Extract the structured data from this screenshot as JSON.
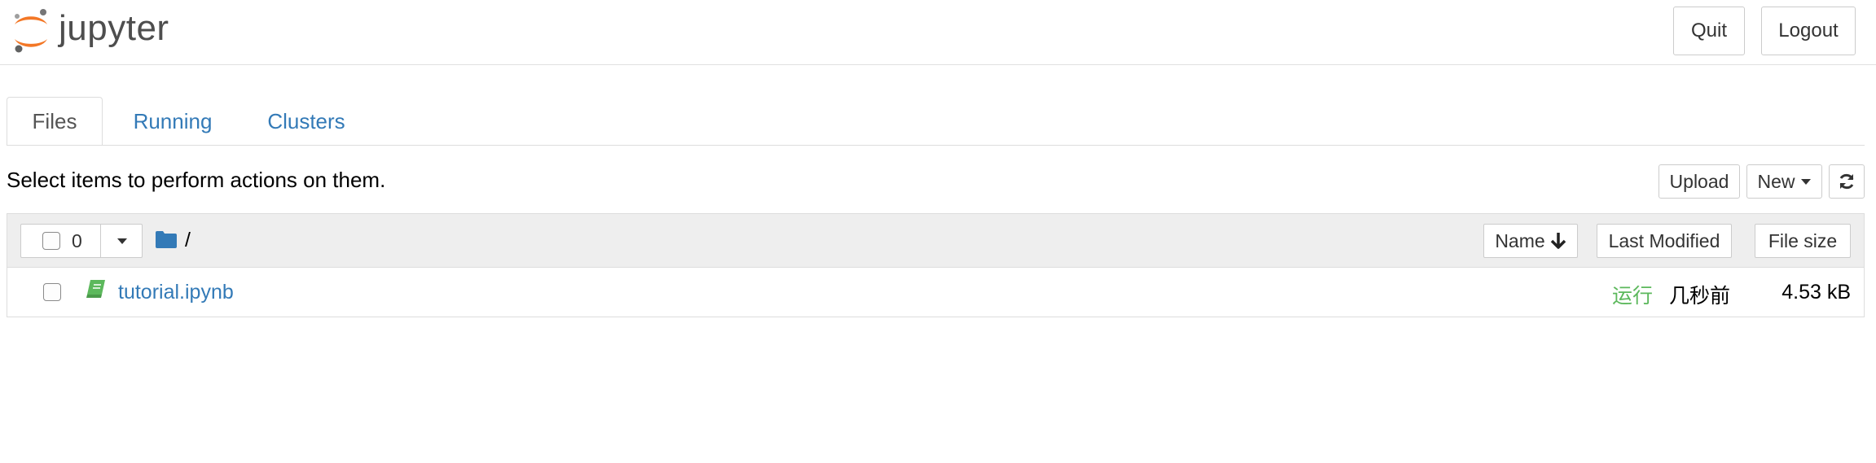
{
  "header": {
    "logo_text": "jupyter",
    "quit_label": "Quit",
    "logout_label": "Logout"
  },
  "tabs": [
    {
      "label": "Files",
      "active": true
    },
    {
      "label": "Running",
      "active": false
    },
    {
      "label": "Clusters",
      "active": false
    }
  ],
  "toolbar": {
    "hint": "Select items to perform actions on them.",
    "upload_label": "Upload",
    "new_label": "New",
    "refresh_icon": "refresh-icon"
  },
  "list": {
    "selected_count": "0",
    "path": "/",
    "columns": {
      "name": "Name",
      "last_modified": "Last Modified",
      "file_size": "File size"
    },
    "items": [
      {
        "name": "tutorial.ipynb",
        "icon": "notebook-icon",
        "status": "运行",
        "modified": "几秒前",
        "size": "4.53 kB"
      }
    ]
  },
  "colors": {
    "link": "#337ab7",
    "running": "#5cb85c",
    "logo_orange": "#f37726",
    "header_bg": "#eeeeee"
  }
}
